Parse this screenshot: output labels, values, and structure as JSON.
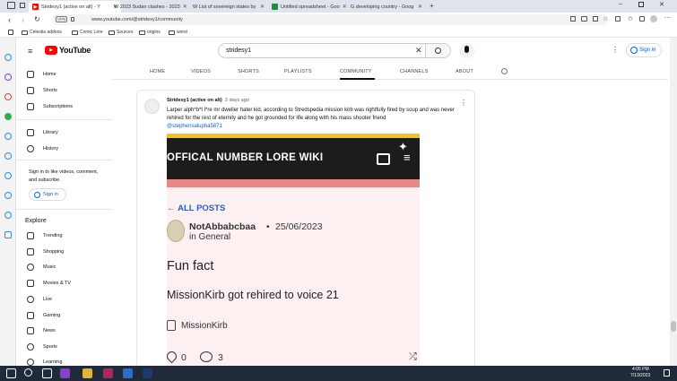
{
  "browser": {
    "tabs": [
      {
        "label": "Stridesy1 (active on alt) - Y",
        "favicon_color": "#ff0000",
        "active": true
      },
      {
        "label": "W 2023 Sudan clashes - 2023",
        "favicon_color": "#555555",
        "active": false
      },
      {
        "label": "W List of sovereign states by",
        "favicon_color": "#555555",
        "active": false
      },
      {
        "label": "Untitled spreadsheet - Goo",
        "favicon_color": "#1e8e3e",
        "active": false
      },
      {
        "label": "G developing country - Goog",
        "favicon_color": "#4285f4",
        "active": false
      }
    ],
    "address": "www.youtube.com/@stridesy1/community",
    "vpn_label": "VPN",
    "bookmarks": [
      "Celestia addons",
      "Comic Lore",
      "Sources",
      "origins",
      "worst"
    ]
  },
  "youtube": {
    "logo_text": "YouTube",
    "search_value": "stridesy1",
    "sign_in": "Sign in",
    "nav": {
      "home": "Home",
      "shorts": "Shorts",
      "subscriptions": "Subscriptions",
      "library": "Library",
      "history": "History",
      "signin_prompt": "Sign in to like videos, comment, and subscribe.",
      "signin_button": "Sign in",
      "explore": "Explore",
      "explore_items": [
        "Trending",
        "Shopping",
        "Music",
        "Movies & TV",
        "Live",
        "Gaming",
        "News",
        "Sports",
        "Learning"
      ]
    },
    "channel_tabs": [
      "HOME",
      "VIDEOS",
      "SHORTS",
      "PLAYLISTS",
      "COMMUNITY",
      "CHANNELS",
      "ABOUT"
    ],
    "post": {
      "author": "Stridesy1 (active on alt)",
      "time": "2 days ago",
      "text": "Larper alph*b*t l*re mr dweller hater kid, according to Stredspedia mission kirb was rightfully fired by soup and was never rehired for the rest of eternity and he got grounded for life along with his mass shooter friend",
      "mention": "@stephensalupha5871",
      "image": {
        "wiki_title": "OFFICAL NUMBER LORE WIKI",
        "all_posts": "ALL POSTS",
        "user": "NotAbbabcbaa",
        "separator": "•",
        "date": "25/06/2023",
        "category": "in General",
        "heading": "Fun fact",
        "body": "MissionKirb got rehired to voice 21",
        "tag": "MissionKirb",
        "likes": "0",
        "comments": "3"
      }
    }
  },
  "taskbar": {
    "time": "4:05 PM",
    "date": "7/13/2023"
  },
  "colors": {
    "youtube_red": "#ff0000",
    "link_blue": "#065fd4",
    "wiki_banner": "#1c1c1c",
    "wiki_stripe_yellow": "#f4c21b",
    "wiki_stripe_pink": "#e98787",
    "wiki_bg": "#fdf0f0",
    "wiki_link_blue": "#2a5bd7",
    "taskbar": "#1f2a3a"
  }
}
